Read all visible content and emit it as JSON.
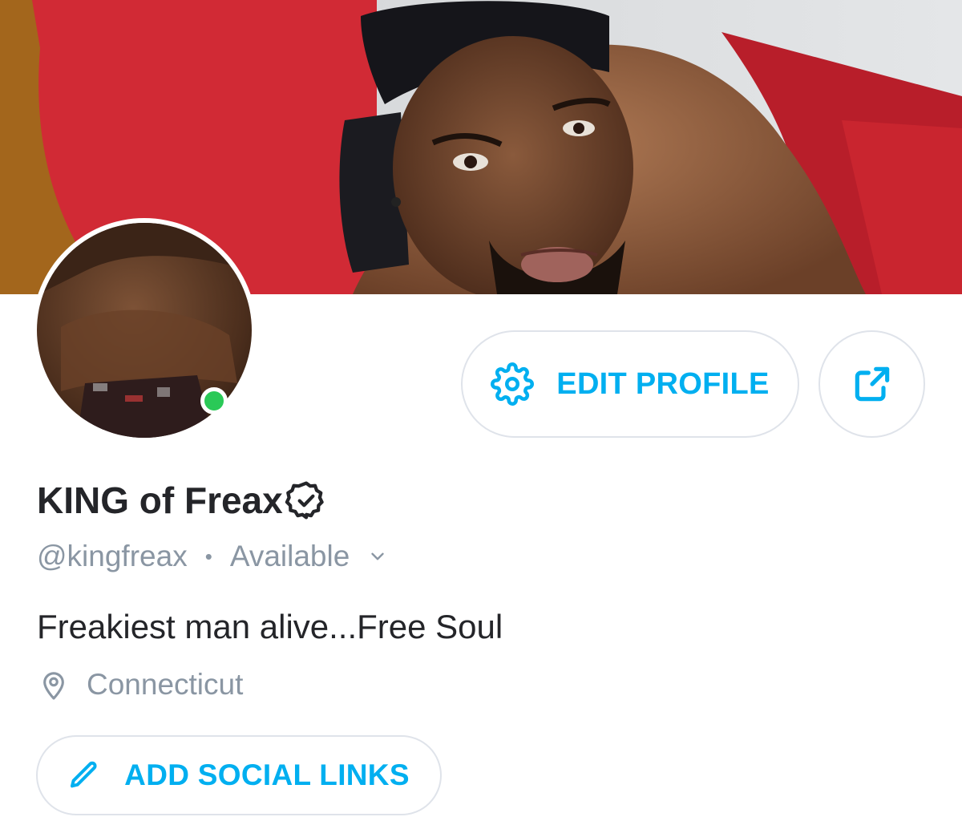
{
  "profile": {
    "display_name": "KING of Freax",
    "handle": "@kingfreax",
    "status": "Available",
    "bio": "Freakiest man alive...Free Soul",
    "location": "Connecticut",
    "online": true
  },
  "buttons": {
    "edit_profile": "EDIT PROFILE",
    "add_social_links": "ADD SOCIAL LINKS"
  },
  "separator": "•",
  "icons": {
    "edit_profile": "gear-icon",
    "share": "share-icon",
    "verified": "verified-badge-icon",
    "status_toggle": "chevron-down-icon",
    "location": "map-pin-icon",
    "social": "pencil-icon"
  },
  "colors": {
    "accent": "#00aff0",
    "online": "#2ac957",
    "text_primary": "#242529",
    "text_secondary": "#8a96a3",
    "border": "#dfe3ea"
  }
}
